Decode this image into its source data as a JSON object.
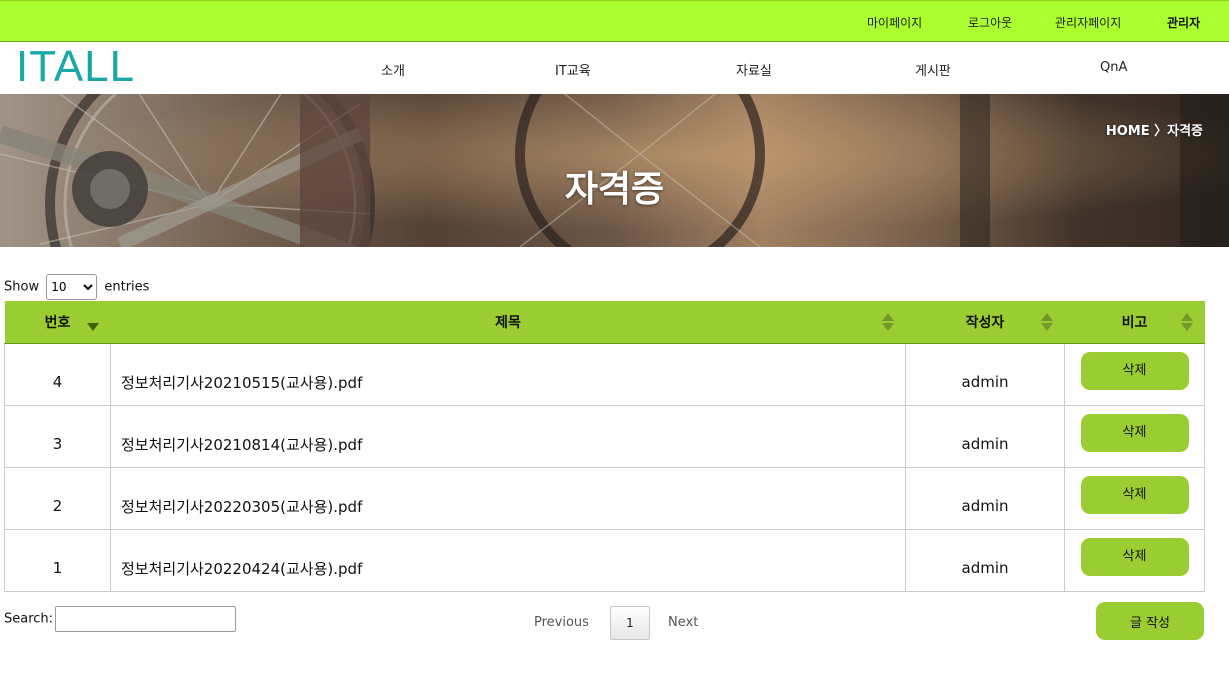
{
  "topbar": {
    "links": [
      "마이페이지",
      "로그아웃",
      "관리자페이지",
      "관리자"
    ]
  },
  "header": {
    "logo": "ITALL",
    "nav": [
      "소개",
      "IT교육",
      "자료실",
      "게시판",
      "QnA"
    ]
  },
  "banner": {
    "breadcrumb": "HOME 〉자격증",
    "title": "자격증"
  },
  "length": {
    "prefix": "Show",
    "selected": "10",
    "suffix": "entries"
  },
  "table": {
    "headers": [
      "번호",
      "제목",
      "작성자",
      "비고"
    ],
    "rows": [
      {
        "num": "4",
        "title": "정보처리기사20210515(교사용).pdf",
        "author": "admin",
        "action": "삭제"
      },
      {
        "num": "3",
        "title": "정보처리기사20210814(교사용).pdf",
        "author": "admin",
        "action": "삭제"
      },
      {
        "num": "2",
        "title": "정보처리기사20220305(교사용).pdf",
        "author": "admin",
        "action": "삭제"
      },
      {
        "num": "1",
        "title": "정보처리기사20220424(교사용).pdf",
        "author": "admin",
        "action": "삭제"
      }
    ]
  },
  "search": {
    "label": "Search:",
    "value": ""
  },
  "pager": {
    "previous": "Previous",
    "current": "1",
    "next": "Next"
  },
  "write_button": "글 작성",
  "colors": {
    "topbar": "#abff31",
    "accent": "#9acd32",
    "logo": "#1aa7a8"
  }
}
